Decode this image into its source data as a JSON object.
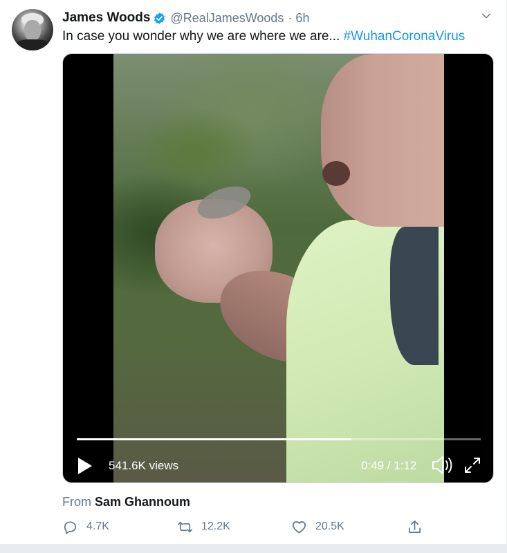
{
  "tweet": {
    "author_name": "James Woods",
    "handle": "@RealJamesWoods",
    "time": "· 6h",
    "text": "In case you wonder why we are where we are... ",
    "hashtag": "#WuhanCoronaVirus"
  },
  "video": {
    "views": "541.6K views",
    "time": "0:49 / 1:12",
    "progress": 0.68
  },
  "attribution": {
    "prefix": "From ",
    "source": "Sam Ghannoum"
  },
  "actions": {
    "replies": "4.7K",
    "retweets": "12.2K",
    "likes": "20.5K"
  },
  "icons": [
    "verified-badge-icon",
    "chevron-down-icon",
    "play-icon",
    "volume-icon",
    "fullscreen-icon",
    "reply-icon",
    "retweet-icon",
    "like-icon",
    "share-icon"
  ],
  "colors": {
    "link": "#1b95e0",
    "verified": "#1da1f2",
    "muted": "#657786"
  }
}
